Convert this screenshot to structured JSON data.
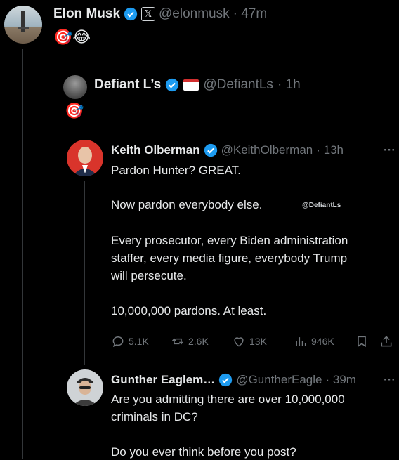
{
  "post_main": {
    "author_name": "Elon Musk",
    "handle": "@elonmusk",
    "time": "· 47m",
    "emoji_text": "🎯😂"
  },
  "post_quote1": {
    "author_name": "Defiant L’s",
    "handle": "@DefiantLs",
    "time": "· 1h",
    "emoji_text": "🎯"
  },
  "post_keith": {
    "author_name": "Keith Olberman",
    "handle": "@KeithOlberman",
    "time": "· 13h",
    "more": "···",
    "lines": [
      "Pardon Hunter? GREAT.",
      "Now pardon everybody else.",
      "Every prosecutor, every Biden administration",
      "staffer, every media figure, everybody Trump",
      "will persecute.",
      "10,000,000 pardons. At least."
    ],
    "watermark": "@DefiantLs",
    "stats": {
      "replies": "5.1K",
      "reposts": "2.6K",
      "likes": "13K",
      "views": "946K"
    }
  },
  "post_gunther": {
    "author_name": "Gunther Eaglem…",
    "handle": "@GuntherEagle",
    "time": "· 39m",
    "more": "···",
    "lines": [
      "Are you admitting there are over 10,000,000",
      "criminals in DC?",
      "Do you ever think before you post?"
    ]
  },
  "colors": {
    "background": "#000000",
    "text": "#e7e9ea",
    "muted": "#71767b",
    "verified": "#1d9bf0",
    "thread_line": "#333639"
  }
}
